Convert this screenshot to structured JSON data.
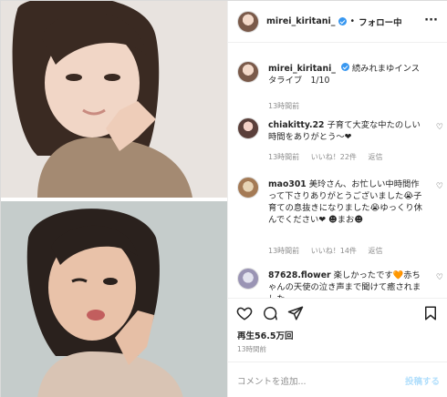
{
  "post": {
    "header": {
      "username": "mirei_kiritani_",
      "separator": "•",
      "follow_label": "フォロー中",
      "more_icon": "more-icon"
    },
    "caption": {
      "username": "mirei_kiritani_",
      "text": "続みれまゆインスタライブ　1/10",
      "time": "13時間前"
    },
    "comments": [
      {
        "username": "chiakitty.22",
        "text": "子育て大変な中たのしい時間をありがとう～❤",
        "time": "13時間前",
        "likes": "いいね！22件",
        "reply": "返信"
      },
      {
        "username": "mao301",
        "text": "美玲さん、お忙しい中時間作って下さりありがとうございました😭子育ての息抜きになりました😭ゆっくり休んでください❤ ☻まお☻",
        "time": "13時間前",
        "likes": "いいね！14件",
        "reply": "返信"
      },
      {
        "username": "87628.flower",
        "text": "楽しかったです🧡赤ちゃんの天使の泣き声まで聞けて癒されました",
        "time": "",
        "likes": "",
        "reply": ""
      }
    ],
    "views": "再生56.5万回",
    "posted": "13時間前",
    "add_comment_placeholder": "コメントを追加...",
    "post_button": "投稿する"
  },
  "colors": {
    "verified": "#3897f0",
    "post_button": "#b2dffc",
    "meta_text": "#8e8e8e"
  }
}
